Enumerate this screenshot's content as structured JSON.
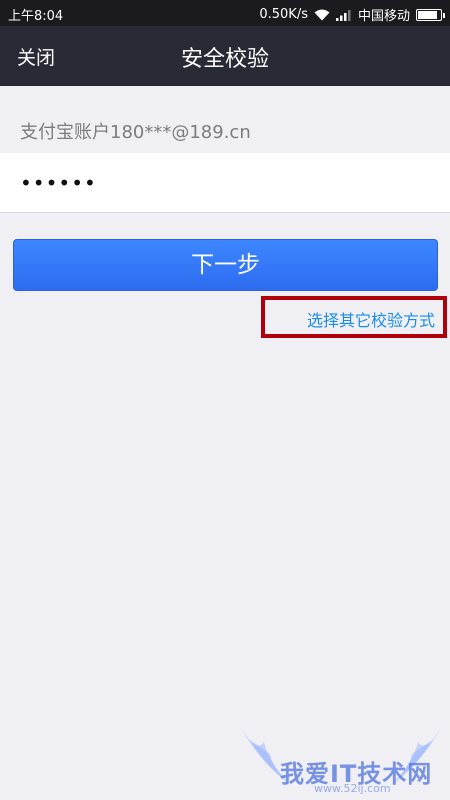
{
  "status_bar": {
    "time": "上午8:04",
    "speed": "0.50K/s",
    "carrier": "中国移动",
    "icons": [
      "wifi-icon",
      "signal-icon",
      "battery-icon"
    ]
  },
  "nav": {
    "close_label": "关闭",
    "title": "安全校验"
  },
  "form": {
    "account_text": "支付宝账户180***@189.cn",
    "password_value": "••••••"
  },
  "actions": {
    "next_label": "下一步",
    "other_method_label": "选择其它校验方式"
  },
  "watermark": {
    "text": "我爱IT技术网",
    "url": "www.52ij.com"
  },
  "colors": {
    "nav_background": "#282a36",
    "status_background": "#1b1b1f",
    "page_background": "#efeff4",
    "primary_button": "#3478f6",
    "link": "#1a8de8",
    "highlight_box": "#b0000b"
  }
}
